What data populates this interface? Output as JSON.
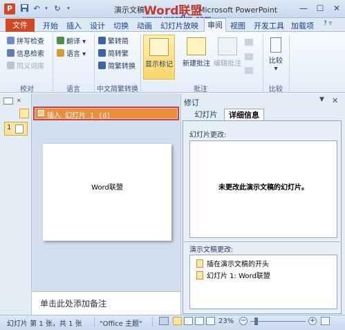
{
  "titlebar": {
    "app_icon": "P",
    "title_prefix": "演示文稿",
    "title_suffix": "Microsoft PowerPoint",
    "watermark_main": "Word联盟",
    "watermark_url": "www.wordlm.com",
    "undo": "↶",
    "redo": "↻",
    "minimize": "—",
    "maximize": "☐",
    "close": "✕"
  },
  "tabs": {
    "file": "文件",
    "items": [
      "开始",
      "插入",
      "设计",
      "切换",
      "动画",
      "幻灯片放映",
      "审阅",
      "视图",
      "开发工具",
      "加载项"
    ]
  },
  "ribbon": {
    "proofing": {
      "items": [
        "拼写检查",
        "信息检索",
        "同义词库"
      ],
      "label": "校对"
    },
    "language": {
      "items": [
        "翻译",
        "语言"
      ],
      "label": "语言"
    },
    "chinese": {
      "items": [
        "繁转简",
        "简转繁",
        "简繁转换"
      ],
      "label": "中文简繁转换"
    },
    "comments": {
      "show_markup": "显示标记",
      "new_comment": "新建批注",
      "edit_comment": "编辑批注",
      "label": "批注"
    },
    "compare": {
      "compare": "比较",
      "label": "比较"
    }
  },
  "thumbs": {
    "slide_number": "1"
  },
  "change_bar": {
    "text": "插入 幻灯片 1 (d)"
  },
  "slide": {
    "text": "Word联盟"
  },
  "notes": {
    "placeholder": "单击此处添加备注"
  },
  "revisions": {
    "title": "修订",
    "tab_slides": "幻灯片",
    "tab_details": "详细信息",
    "slide_changes_label": "幻灯片更改:",
    "slide_changes_text": "未更改此演示文稿的幻灯片。",
    "pres_changes_label": "演示文稿更改:",
    "pres_changes": [
      "插在演示文稿的开头",
      "幻灯片 1: Word联盟"
    ]
  },
  "status": {
    "slide_info": "幻灯片 第 1 张，共 1 张",
    "theme": "\"Office 主题\"",
    "zoom": "23%"
  }
}
